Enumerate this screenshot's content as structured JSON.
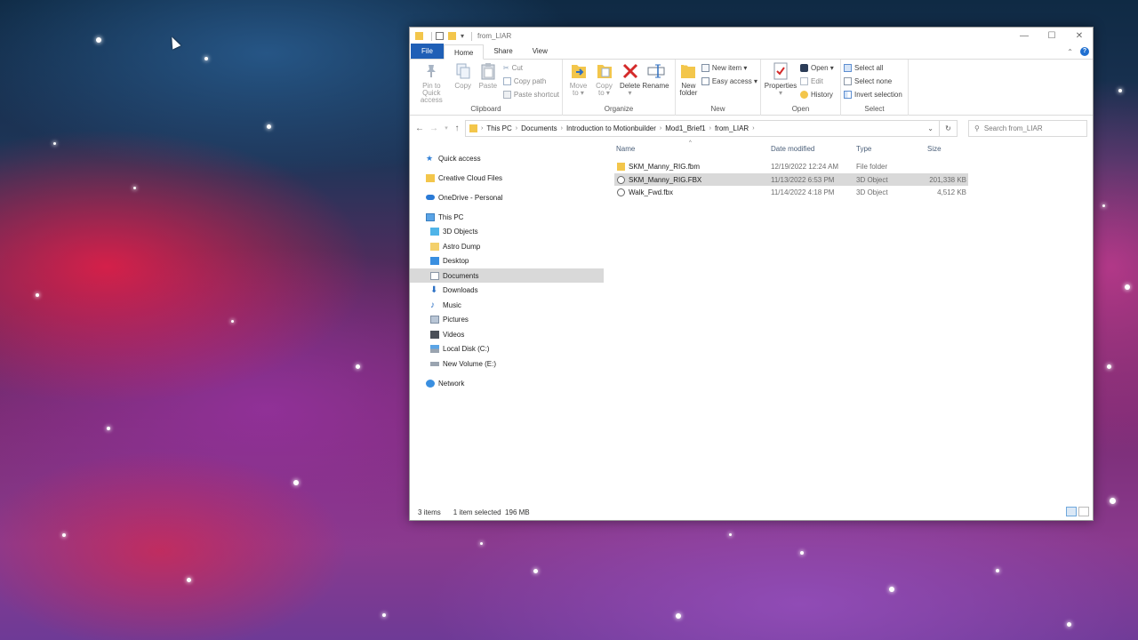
{
  "window": {
    "title": "from_LIAR",
    "controls": {
      "minimize": "—",
      "maximize": "☐",
      "close": "✕"
    }
  },
  "ribbon_tabs": [
    {
      "label": "File"
    },
    {
      "label": "Home"
    },
    {
      "label": "Share"
    },
    {
      "label": "View"
    }
  ],
  "ribbon": {
    "clipboard": {
      "label": "Clipboard",
      "pin": "Pin to Quick access",
      "pin_l1": "Pin to Quick",
      "pin_l2": "access",
      "copy": "Copy",
      "paste": "Paste",
      "cut": "Cut",
      "copy_path": "Copy path",
      "paste_shortcut": "Paste shortcut"
    },
    "organize": {
      "label": "Organize",
      "move_l1": "Move",
      "move_l2": "to ▾",
      "copy_l1": "Copy",
      "copy_l2": "to ▾",
      "delete_l1": "Delete",
      "delete_l2": "▾",
      "rename": "Rename"
    },
    "new": {
      "label": "New",
      "folder_l1": "New",
      "folder_l2": "folder",
      "new_item": "New item ▾",
      "easy_access": "Easy access ▾"
    },
    "open": {
      "label": "Open",
      "properties_l1": "Properties",
      "properties_l2": "▾",
      "open": "Open ▾",
      "edit": "Edit",
      "history": "History"
    },
    "select": {
      "label": "Select",
      "select_all": "Select all",
      "select_none": "Select none",
      "invert": "Invert selection"
    }
  },
  "address": {
    "crumbs": [
      "This PC",
      "Documents",
      "Introduction to Motionbuilder",
      "Mod1_Brief1",
      "from_LIAR"
    ],
    "search_placeholder": "Search from_LIAR"
  },
  "nav": {
    "quick_access": "Quick access",
    "creative_cloud": "Creative Cloud Files",
    "onedrive": "OneDrive - Personal",
    "this_pc": "This PC",
    "objects3d": "3D Objects",
    "astro_dump": "Astro Dump",
    "desktop": "Desktop",
    "documents": "Documents",
    "downloads": "Downloads",
    "music": "Music",
    "pictures": "Pictures",
    "videos": "Videos",
    "local_disk": "Local Disk (C:)",
    "new_volume": "New Volume (E:)",
    "network": "Network"
  },
  "columns": {
    "name": "Name",
    "date": "Date modified",
    "type": "Type",
    "size": "Size"
  },
  "files": [
    {
      "name": "SKM_Manny_RIG.fbm",
      "date": "12/19/2022 12:24 AM",
      "type": "File folder",
      "size": "",
      "icon": "folder-icon"
    },
    {
      "name": "SKM_Manny_RIG.FBX",
      "date": "11/13/2022 6:53 PM",
      "type": "3D Object",
      "size": "201,338 KB",
      "icon": "3d-object-icon"
    },
    {
      "name": "Walk_Fwd.fbx",
      "date": "11/14/2022 4:18 PM",
      "type": "3D Object",
      "size": "4,512 KB",
      "icon": "3d-object-icon"
    }
  ],
  "status": {
    "items": "3 items",
    "selected": "1 item selected  196 MB"
  }
}
